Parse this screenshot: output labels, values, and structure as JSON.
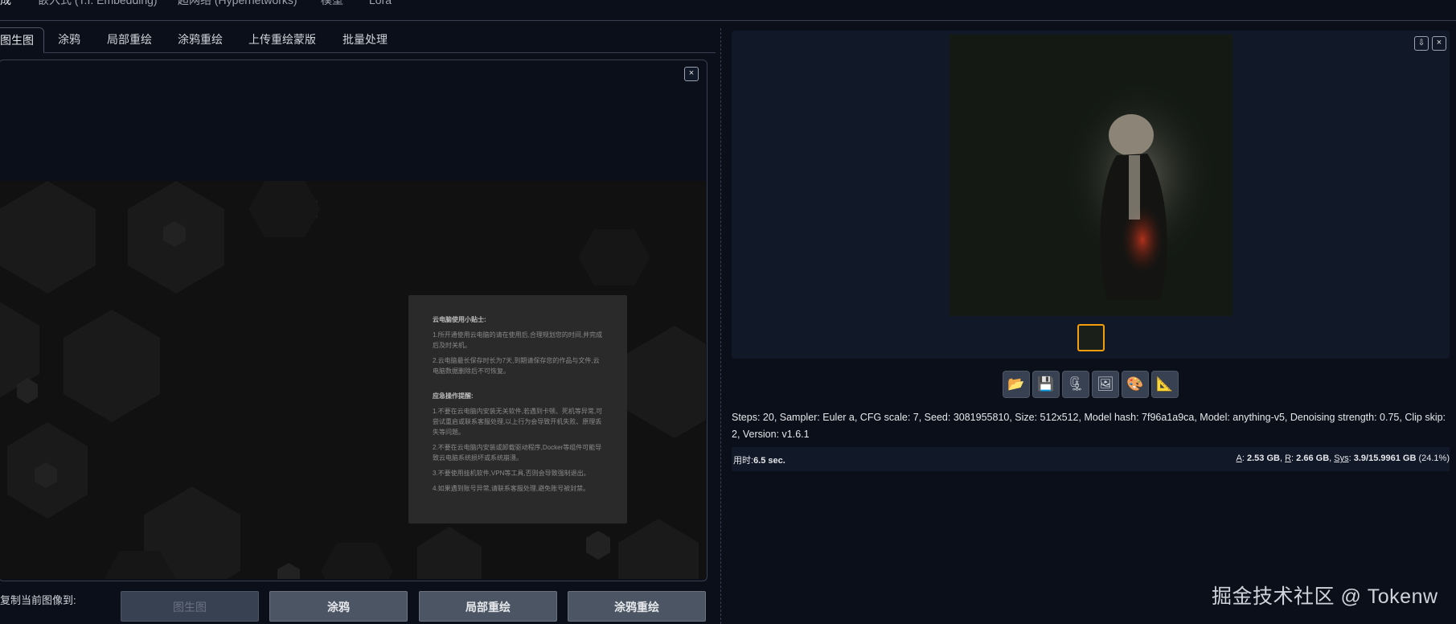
{
  "top_tabs": [
    "生成",
    "嵌入式 (T.I. Embedding)",
    "超网络 (Hypernetworks)",
    "模型",
    "Lora"
  ],
  "sub_tabs": [
    "图生图",
    "涂鸦",
    "局部重绘",
    "涂鸦重绘",
    "上传重绘蒙版",
    "批量处理"
  ],
  "left_panel": {
    "close_icon": "×",
    "tip_card": {
      "title1": "云电脑使用小贴士:",
      "p1": "1.所开通使用云电脑的请在使用后,合理规划您的时间,并完成后及时关机。",
      "p2": "2.云电脑最长保存时长为7天,到期请保存您的作品与文件,云电脑数据删除后不可恢复。",
      "title2": "应急操作提醒:",
      "p3": "1.不要在云电脑内安装无关软件,若遇到卡顿、死机等异常,可尝试重启或联系客服处理,以上行为会导致开机失败、原理丢失等问题。",
      "p4": "2.不要在云电脑内安装或卸载驱动程序,Docker等组件可能导致云电脑系统损坏或系统崩溃。",
      "p5": "3.不要使用挂机软件,VPN等工具,否则会导致强制退出。",
      "p6": "4.如果遇到账号异常,请联系客服处理,避免账号被封禁。"
    }
  },
  "copy_row": {
    "label": "复制当前图像到:",
    "buttons": [
      "图生图",
      "涂鸦",
      "局部重绘",
      "涂鸦重绘"
    ]
  },
  "right_panel": {
    "download_icon": "⇩",
    "close_icon": "×",
    "tool_buttons": [
      {
        "name": "folder-icon",
        "glyph": "📂"
      },
      {
        "name": "save-icon",
        "glyph": "💾"
      },
      {
        "name": "zip-icon",
        "glyph": "🗜"
      },
      {
        "name": "image-icon",
        "glyph": "🖼"
      },
      {
        "name": "palette-icon",
        "glyph": "🎨"
      },
      {
        "name": "triangle-ruler-icon",
        "glyph": "📐"
      }
    ],
    "generation_info": "Steps: 20, Sampler: Euler a, CFG scale: 7, Seed: 3081955810, Size: 512x512, Model hash: 7f96a1a9ca, Model: anything-v5, Denoising strength: 0.75, Clip skip: 2, Version: v1.6.1",
    "time_label": "用时:",
    "time_value": "6.5 sec.",
    "vram_a_label": "A",
    "vram_a_value": "2.53 GB",
    "vram_r_label": "R",
    "vram_r_value": "2.66 GB",
    "sys_label": "Sys",
    "sys_value": "3.9/15.9961 GB",
    "sys_pct": "(24.1%)"
  },
  "watermark": "掘金技术社区 @ Tokenw"
}
